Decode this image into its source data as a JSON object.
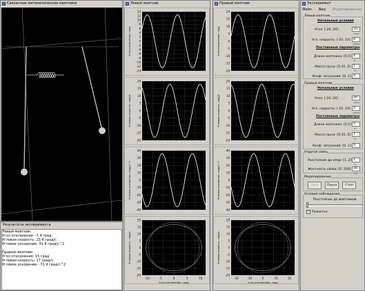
{
  "windows": {
    "animation_title": "Связанные математические маятники",
    "left_title": "Левый маятник",
    "right_title": "Правый маятник",
    "experiment_title": "Эксперимент"
  },
  "results": {
    "title": "Результаты эксперимента",
    "lines": [
      "Левый маятник:",
      "Угол отклонения: -7.4 град",
      "Угловая скорость: 13.4 град/с",
      "Угловое ускорение: 31.8 град/с^2",
      "",
      "Правый маятник:",
      "Угол отклонения: 15 град",
      "Угловая скорость: 17 град/с",
      "Угловое ускорение: -72.9 град/с^2"
    ]
  },
  "menu": {
    "file": "Файл",
    "view": "Вид",
    "modeling": "Моделирование"
  },
  "experiment": {
    "left_group": "Левый маятник",
    "initial_conditions": "Начальные условия",
    "angle_label": "Угол: [-20..20]",
    "angle_value": "10",
    "angle_unit": "град",
    "speed_label": "Угл. скорость: [-10..10]",
    "left_speed_value": "0",
    "speed_unit": "град/с",
    "constants": "Постоянные параметры",
    "length_label": "Длина маятника: [0.5]",
    "left_length_value": "4",
    "length_unit": "м",
    "mass_label": "Масса груза: [0.01..5]",
    "left_mass_value": "1",
    "mass_unit": "кг",
    "damping_label": "Коэф. затухания: [0..1]",
    "left_damping_value": "0",
    "right_group": "Правый маятник",
    "right_angle_value": "20",
    "right_speed_value": "0",
    "right_length_value": "3",
    "right_mass_value": "1",
    "right_damping_value": "0",
    "spring_group": "Упругая связь",
    "distance_label": "Расстояние до опор: [1..2]",
    "distance_value": "1",
    "stiffness_label": "Жесткость связи: [0..100]",
    "stiffness_value": "20",
    "stiffness_unit": "н/м",
    "modeling_group": "Моделирование",
    "btn_start": "Пуск",
    "btn_pause": "Пауза",
    "btn_stop": "Стоп",
    "observation_group": "Условия наблюдения",
    "distance_to_pendulums": "Расстояние до маятников",
    "grid_label": "Разметка",
    "grid_checked": "✓"
  },
  "plots": {
    "ylabels": [
      "Угол отклонения, град",
      "Угловая скорость, град/с",
      "Угловое ускорение, град/с^2",
      "Угловая скорость, град/с"
    ],
    "xlabel": "Угол отклонения, град",
    "left_ticks": [
      [
        "14",
        "12",
        "10",
        "8",
        "6",
        "4",
        "2",
        "0",
        "-2",
        "-4",
        "-6",
        "-8",
        "-10",
        "-12",
        "-14"
      ],
      [
        "20",
        "15",
        "10",
        "5",
        "0",
        "-5",
        "-10",
        "-15",
        "-20"
      ],
      [
        "40",
        "30",
        "20",
        "10",
        "0",
        "-10",
        "-20",
        "-30",
        "-40"
      ],
      [
        "20",
        "15",
        "10",
        "5",
        "0",
        "-5",
        "-10",
        "-15",
        "-20"
      ]
    ],
    "right_ticks": [
      [
        "20",
        "15",
        "10",
        "5",
        "0",
        "-5",
        "-10",
        "-15",
        "-20"
      ],
      [
        "20",
        "15",
        "10",
        "5",
        "0",
        "-5",
        "-10",
        "-15",
        "-20"
      ],
      [
        "40",
        "30",
        "20",
        "10",
        "0",
        "-10",
        "-20",
        "-30",
        "-40"
      ],
      [
        "20",
        "15",
        "10",
        "5",
        "0",
        "-5",
        "-10",
        "-15",
        "-20"
      ]
    ],
    "left_xticks": [
      "-10",
      "-5",
      "0",
      "5",
      "10"
    ],
    "right_xticks": [
      "-20",
      "-10",
      "0",
      "10",
      "20"
    ]
  },
  "colors": {
    "plot_bg": "#000000",
    "curve": "#ffffff",
    "grid": "#c8c8c8"
  }
}
